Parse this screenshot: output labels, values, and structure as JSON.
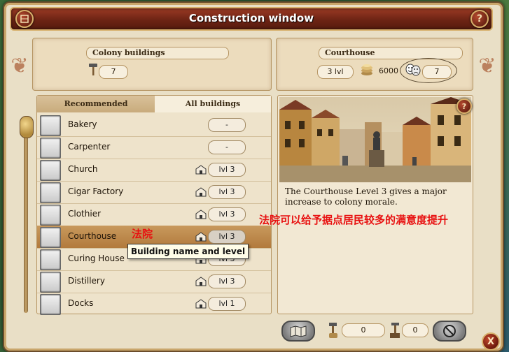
{
  "window": {
    "title": "Construction window"
  },
  "colony": {
    "label": "Colony buildings",
    "builders_count": "7"
  },
  "selected_building": {
    "label": "Courthouse",
    "level": "3 lvl",
    "cost": "6000",
    "morale": "7"
  },
  "tabs": {
    "recommended": "Recommended",
    "all": "All buildings"
  },
  "buildings": [
    {
      "name": "Bakery",
      "level": "-"
    },
    {
      "name": "Carpenter",
      "level": "-"
    },
    {
      "name": "Church",
      "level": "lvl 3"
    },
    {
      "name": "Cigar Factory",
      "level": "lvl 3"
    },
    {
      "name": "Clothier",
      "level": "lvl 3"
    },
    {
      "name": "Courthouse",
      "level": "lvl 3"
    },
    {
      "name": "Curing House",
      "level": "lvl 3"
    },
    {
      "name": "Distillery",
      "level": "lvl 3"
    },
    {
      "name": "Docks",
      "level": "lvl 1"
    }
  ],
  "tooltip": "Building name and level",
  "annotations": {
    "court": "法院",
    "court_note": "法院可以给予据点居民较多的满意度提升"
  },
  "detail": {
    "description": "The Courthouse Level 3 gives a major increase to colony morale."
  },
  "bottom": {
    "tools_count": "0",
    "workers_count": "0"
  },
  "buttons": {
    "help": "?",
    "close": "X"
  }
}
